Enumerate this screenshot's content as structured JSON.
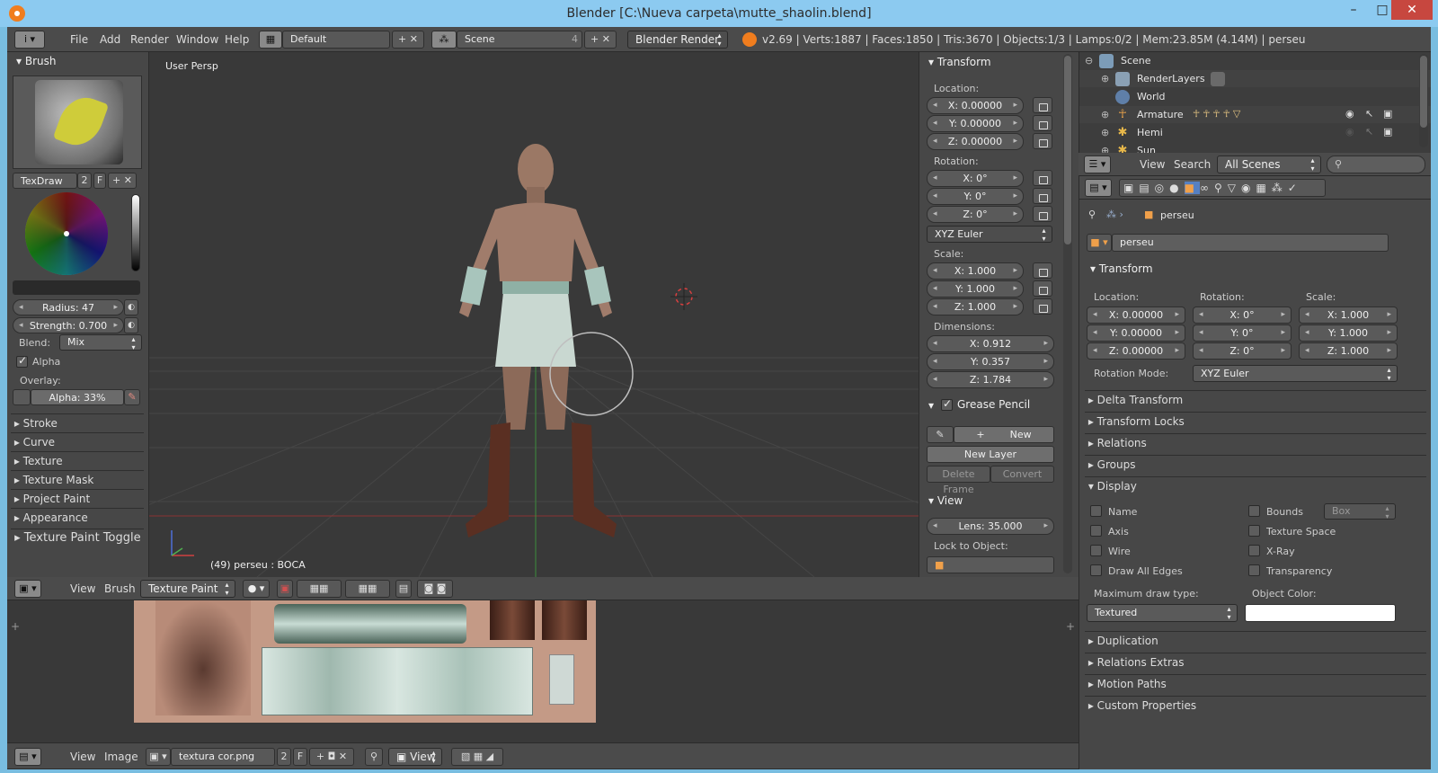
{
  "window": {
    "title": "Blender [C:\\Nueva carpeta\\mutte_shaolin.blend]",
    "minimize": "–",
    "maximize": "□",
    "close": "✕"
  },
  "info_header": {
    "menus": [
      "File",
      "Add",
      "Render",
      "Window",
      "Help"
    ],
    "layout": "Default",
    "scene": "Scene",
    "scene_users": "4",
    "engine": "Blender Render",
    "stats": "v2.69 | Verts:1887 | Faces:1850 | Tris:3670 | Objects:1/3 | Lamps:0/2 | Mem:23.85M (4.14M) | perseu"
  },
  "tool_shelf": {
    "brush_title": "Brush",
    "brush_name": "TexDraw",
    "brush_users": "2",
    "brush_f": "F",
    "radius": "Radius: 47",
    "strength": "Strength: 0.700",
    "blend_label": "Blend:",
    "blend_value": "Mix",
    "alpha_check": "Alpha",
    "overlay_label": "Overlay:",
    "overlay_alpha": "Alpha: 33%",
    "sections": [
      "Stroke",
      "Curve",
      "Texture",
      "Texture Mask",
      "Project Paint",
      "Appearance",
      "Texture Paint Toggle"
    ]
  },
  "viewport": {
    "view_name": "User Persp",
    "object_info": "(49) perseu : BOCA"
  },
  "properties_shelf": {
    "transform_title": "Transform",
    "location_label": "Location:",
    "location": [
      "X: 0.00000",
      "Y: 0.00000",
      "Z: 0.00000"
    ],
    "rotation_label": "Rotation:",
    "rotation": [
      "X: 0°",
      "Y: 0°",
      "Z: 0°"
    ],
    "rotation_mode": "XYZ Euler",
    "scale_label": "Scale:",
    "scale": [
      "X: 1.000",
      "Y: 1.000",
      "Z: 1.000"
    ],
    "dimensions_label": "Dimensions:",
    "dimensions": [
      "X: 0.912",
      "Y: 0.357",
      "Z: 1.784"
    ],
    "grease_title": "Grease Pencil",
    "new": "New",
    "new_layer": "New Layer",
    "delete_frame": "Delete Frame",
    "convert": "Convert",
    "view_title": "View",
    "lens": "Lens: 35.000",
    "lock_object": "Lock to Object:"
  },
  "view3d_header": {
    "menus": [
      "View",
      "Brush"
    ],
    "mode": "Texture Paint"
  },
  "image_header": {
    "menus": [
      "View",
      "Image"
    ],
    "image_name": "textura cor.png",
    "users": "2",
    "f": "F",
    "view": "View"
  },
  "outliner": {
    "items": [
      "Scene",
      "RenderLayers",
      "World",
      "Armature",
      "Hemi",
      "Sun"
    ],
    "menus": [
      "View",
      "Search"
    ],
    "filter": "All Scenes"
  },
  "properties": {
    "object_path": "perseu",
    "object_name": "perseu",
    "transform_title": "Transform",
    "location_label": "Location:",
    "rotation_label": "Rotation:",
    "scale_label": "Scale:",
    "location": [
      "X: 0.00000",
      "Y: 0.00000",
      "Z: 0.00000"
    ],
    "rotation": [
      "X: 0°",
      "Y: 0°",
      "Z: 0°"
    ],
    "scale": [
      "X: 1.000",
      "Y: 1.000",
      "Z: 1.000"
    ],
    "rotation_mode_label": "Rotation Mode:",
    "rotation_mode": "XYZ Euler",
    "sections_top": [
      "Delta Transform",
      "Transform Locks",
      "Relations",
      "Groups"
    ],
    "display_title": "Display",
    "display_left": [
      "Name",
      "Axis",
      "Wire",
      "Draw All Edges"
    ],
    "display_right": [
      "Bounds",
      "Texture Space",
      "X-Ray",
      "Transparency"
    ],
    "bounds_type": "Box",
    "max_draw_label": "Maximum draw type:",
    "max_draw_value": "Textured",
    "object_color_label": "Object Color:",
    "sections_bottom": [
      "Duplication",
      "Relations Extras",
      "Motion Paths",
      "Custom Properties"
    ]
  },
  "colors": {
    "accent": "#f07d1e",
    "selected": "#5680c2",
    "background": "#3a3a3a"
  }
}
